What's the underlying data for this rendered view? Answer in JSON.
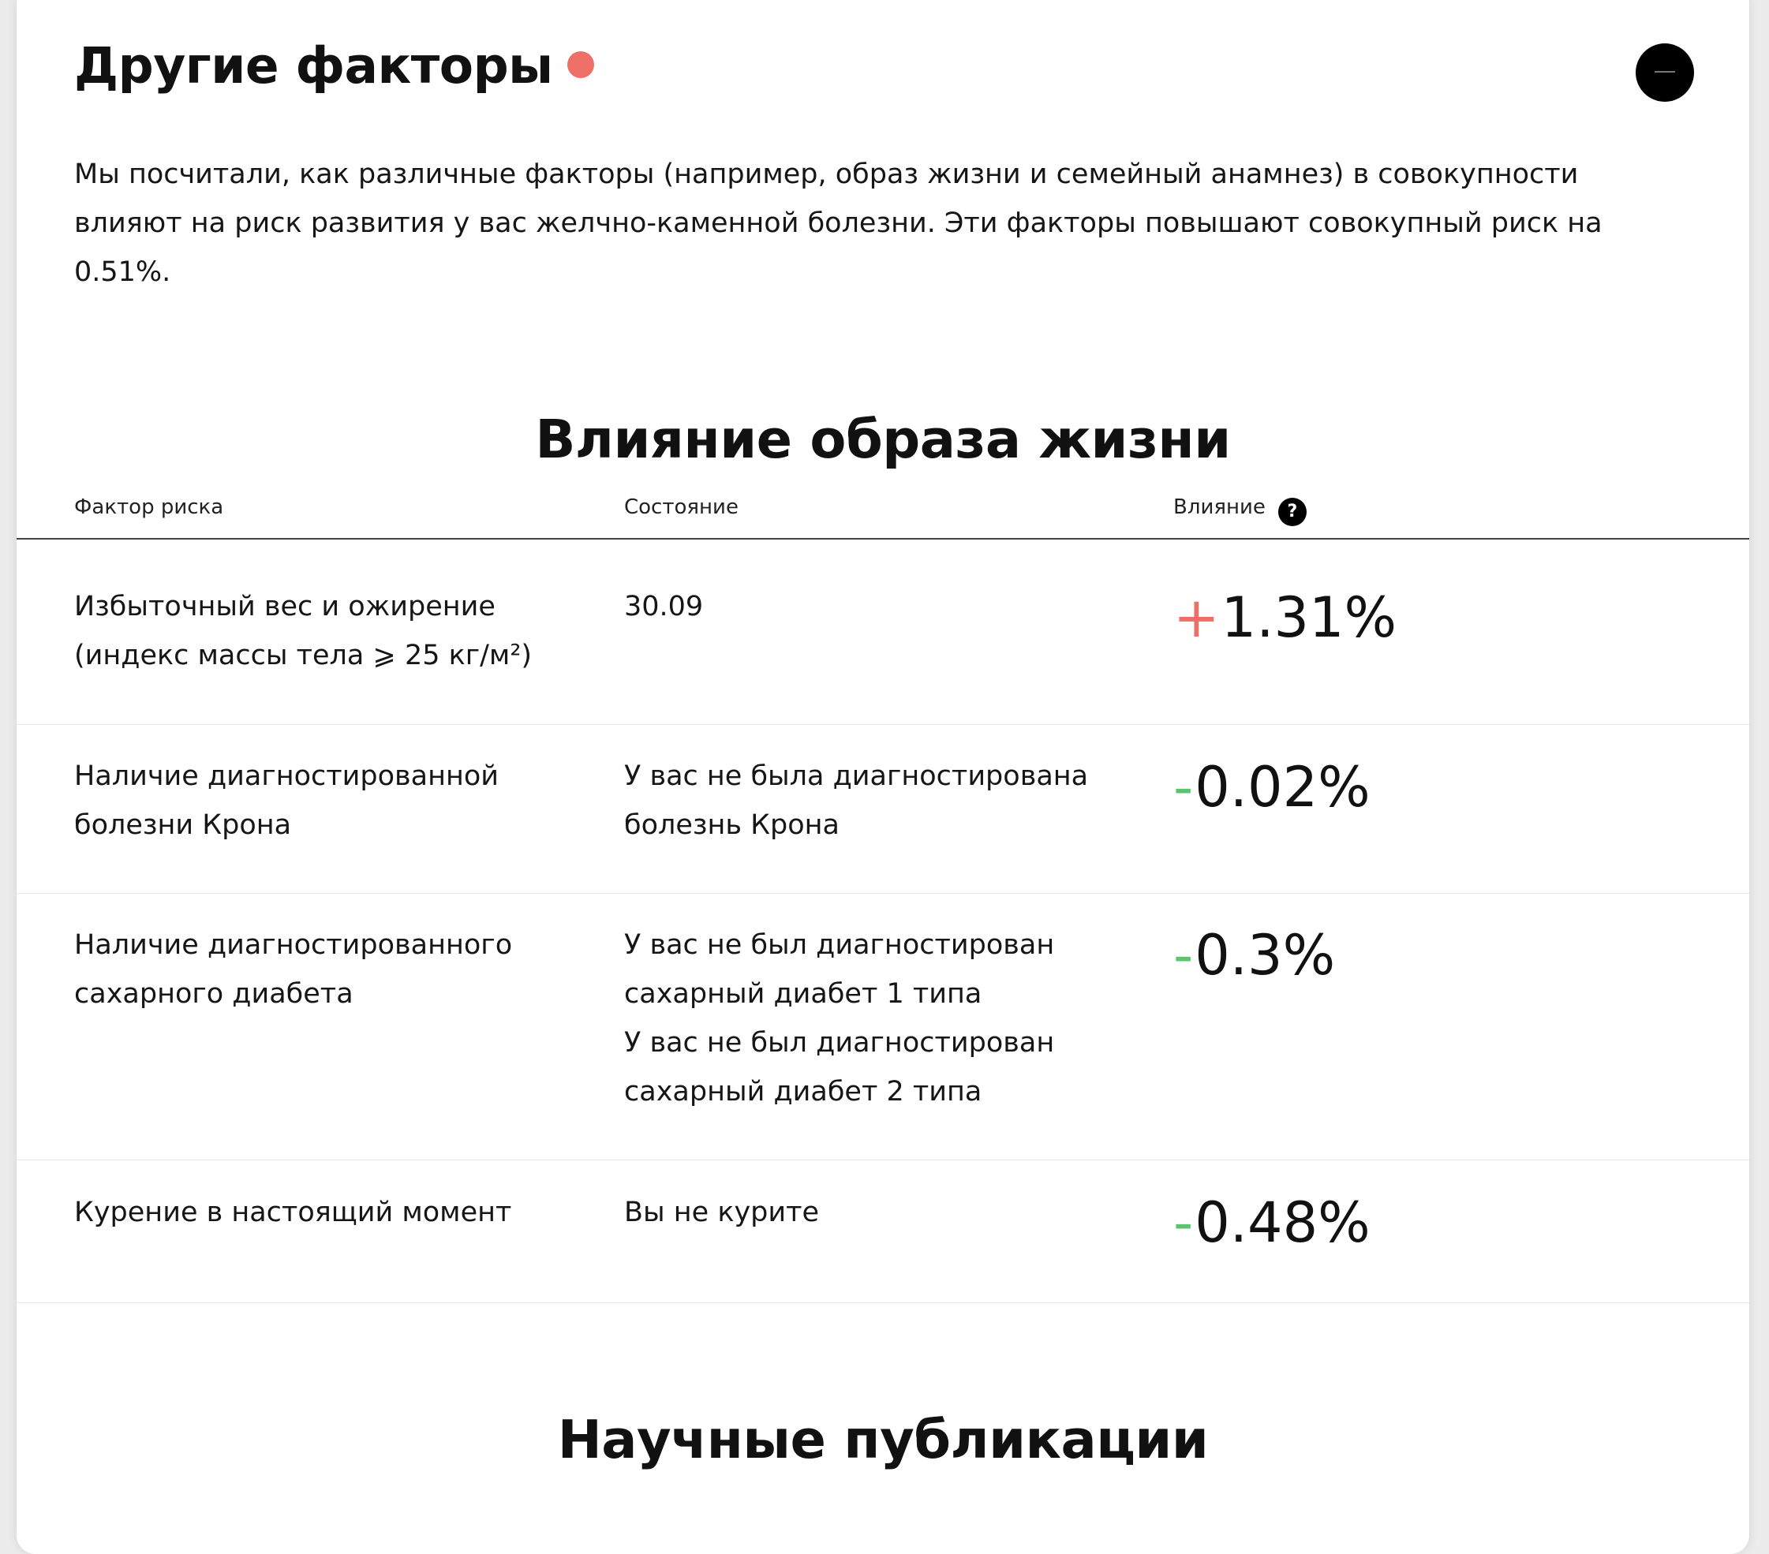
{
  "card": {
    "title": "Другие факторы",
    "status_dot_color": "#ee6f66",
    "collapse_icon": "minus-icon",
    "intro": "Мы посчитали, как различные факторы (например, образ жизни и семейный анамнез) в совокупности влияют на риск развития у вас желчно-каменной болезни. Эти факторы повышают совокупный риск на 0.51%."
  },
  "lifestyle": {
    "title": "Влияние образа жизни",
    "columns": {
      "factor": "Фактор риска",
      "state": "Состояние",
      "impact": "Влияние",
      "help_glyph": "?"
    },
    "colors": {
      "increase": "#ee6f66",
      "decrease": "#5dc46e"
    },
    "rows": [
      {
        "factor": "Избыточный вес и ожирение (индекс массы тела ⩾ 25 кг/м²)",
        "state": [
          "30.09"
        ],
        "impact_sign": "+",
        "impact_value": "1.31%"
      },
      {
        "factor": "Наличие диагностированной болезни Крона",
        "state": [
          "У вас не была диагностирована болезнь Крона"
        ],
        "impact_sign": "-",
        "impact_value": "0.02%"
      },
      {
        "factor": "Наличие диагностированного сахарного диабета",
        "state": [
          "У вас не был диагностирован сахарный диабет 1 типа",
          "У вас не был диагностирован сахарный диабет 2 типа"
        ],
        "impact_sign": "-",
        "impact_value": "0.3%"
      },
      {
        "factor": "Курение в настоящий момент",
        "state": [
          "Вы не курите"
        ],
        "impact_sign": "-",
        "impact_value": "0.48%"
      }
    ]
  },
  "publications": {
    "title": "Научные публикации"
  }
}
